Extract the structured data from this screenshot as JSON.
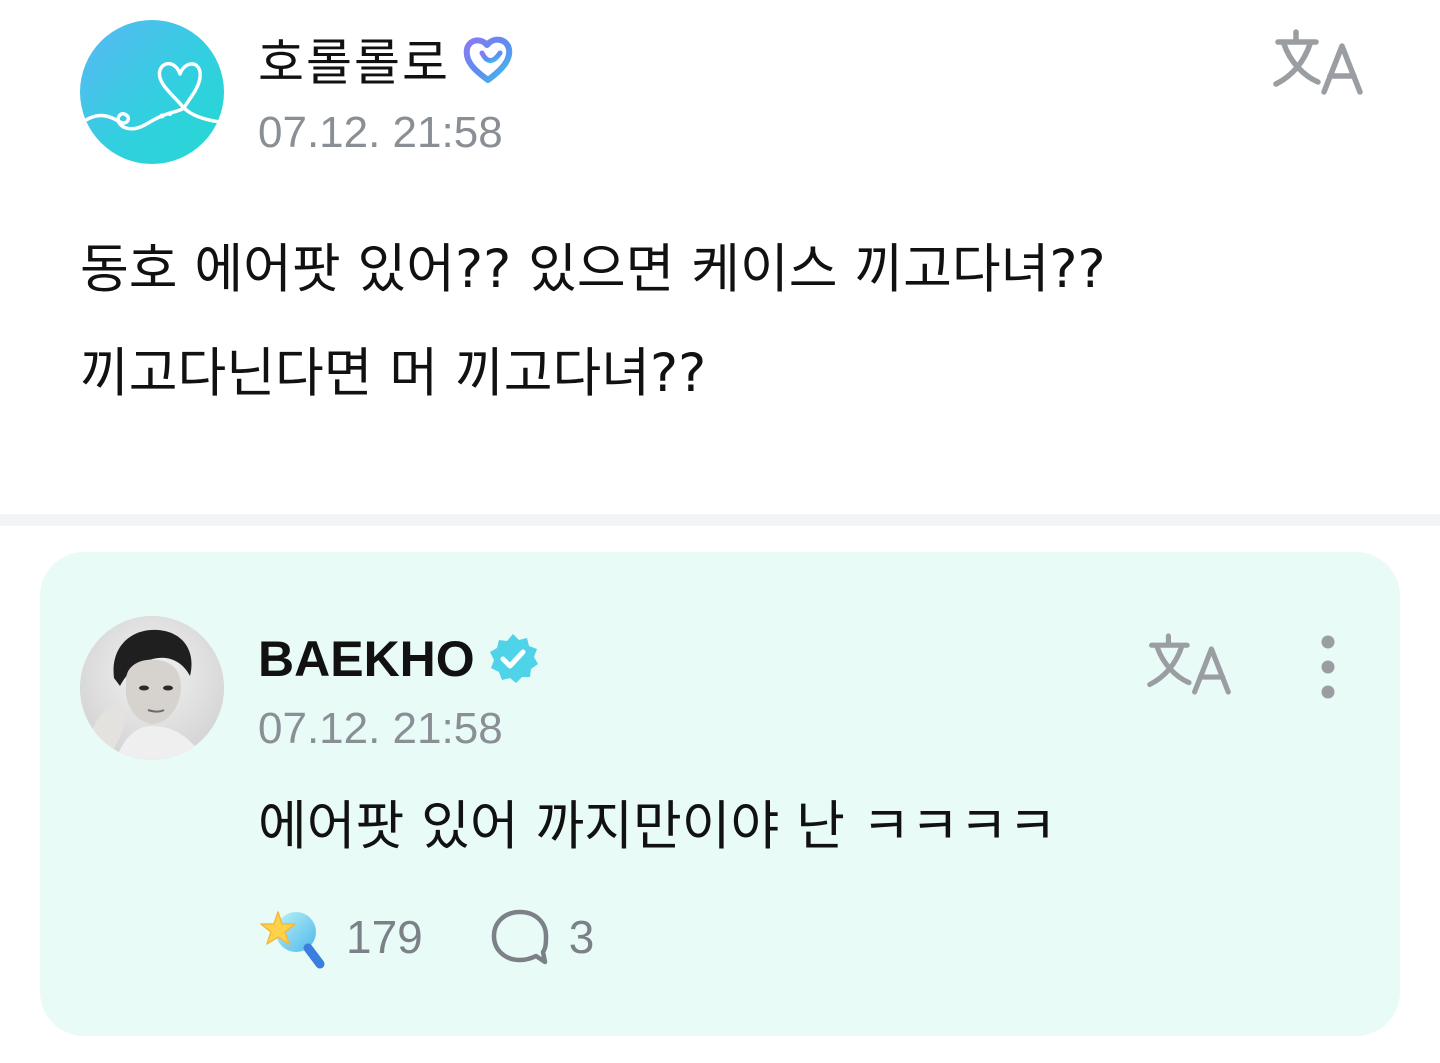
{
  "post": {
    "author_name": "호롤롤로",
    "badge_icon": "fan-heart-badge-icon",
    "timestamp": "07.12. 21:58",
    "translate_icon": "translate-icon",
    "body": "동호 에어팟 있어?? 있으면 케이스 끼고다녀??\n끼고다닌다면 머 끼고다녀??"
  },
  "reply": {
    "author_name": "BAEKHO",
    "badge_icon": "verified-check-icon",
    "timestamp": "07.12. 21:58",
    "translate_icon": "translate-icon",
    "more_icon": "more-vertical-icon",
    "body": "에어팟 있어 까지만이야 난 ㅋㅋㅋㅋ",
    "like_count": "179",
    "comment_count": "3"
  },
  "colors": {
    "card_background": "#e8fbf7",
    "verified_badge": "#4fd3e8",
    "meta_text": "#8a8f96",
    "count_text": "#7c8187"
  }
}
